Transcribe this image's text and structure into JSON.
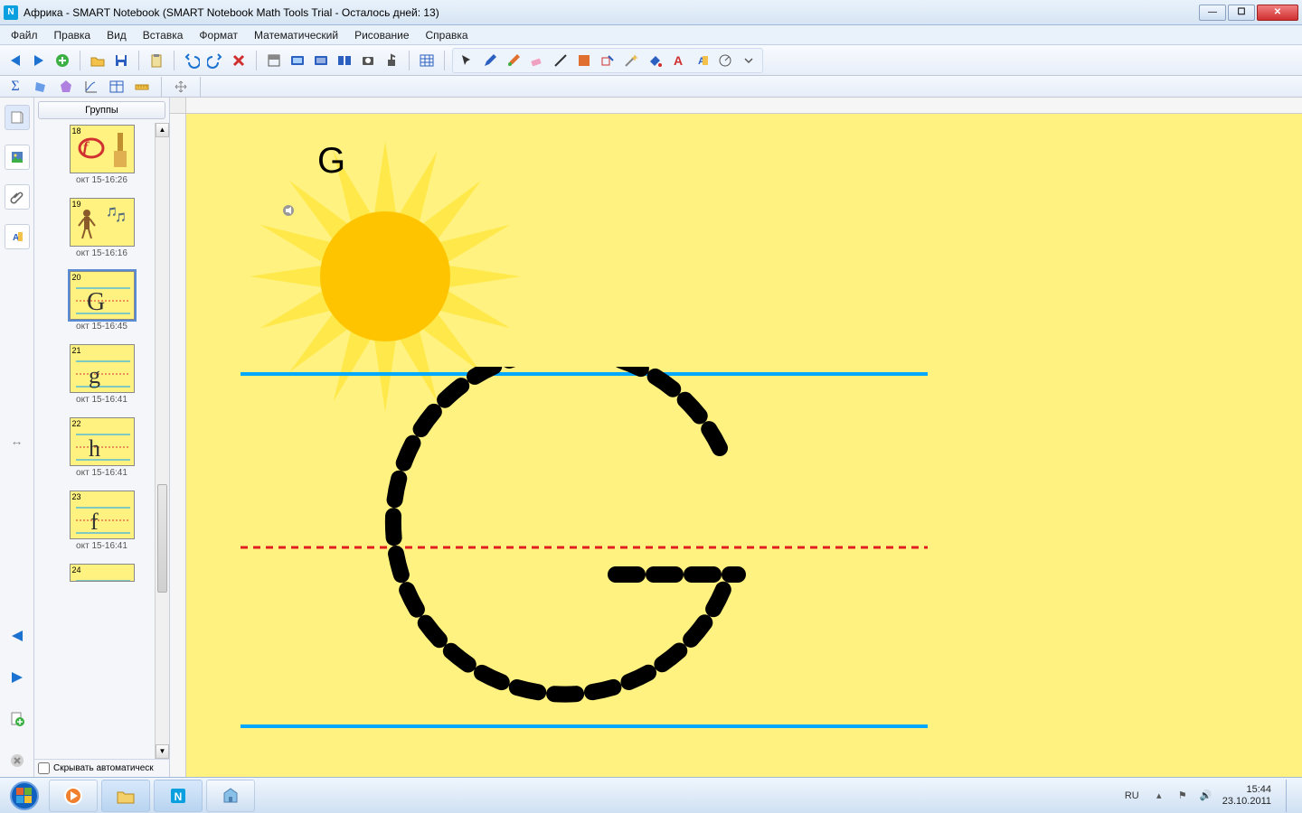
{
  "window": {
    "title": "Африка - SMART Notebook (SMART Notebook Math Tools Trial - Осталось дней: 13)",
    "app_icon_letter": "N"
  },
  "menu": {
    "file": "Файл",
    "edit": "Правка",
    "view": "Вид",
    "insert": "Вставка",
    "format": "Формат",
    "math": "Математический",
    "draw": "Рисование",
    "help": "Справка"
  },
  "sidebar": {
    "groups_button": "Группы",
    "hide_auto_label": "Скрывать автоматическ",
    "thumbs": [
      {
        "page": "18",
        "caption": "окт 15-16:26"
      },
      {
        "page": "19",
        "caption": "окт 15-16:16"
      },
      {
        "page": "20",
        "caption": "окт 15-16:45",
        "selected": true,
        "dropdown": "▼"
      },
      {
        "page": "21",
        "caption": "окт 15-16:41"
      },
      {
        "page": "22",
        "caption": "окт 15-16:41"
      },
      {
        "page": "23",
        "caption": "окт 15-16:41"
      },
      {
        "page": "24",
        "caption": ""
      }
    ]
  },
  "canvas": {
    "letter": "G"
  },
  "toolbar2": {
    "sigma": "Σ"
  },
  "taskbar": {
    "lang": "RU",
    "time": "15:44",
    "date": "23.10.2011"
  },
  "win_controls": {
    "min": "—",
    "max": "☐",
    "close": "✕"
  }
}
